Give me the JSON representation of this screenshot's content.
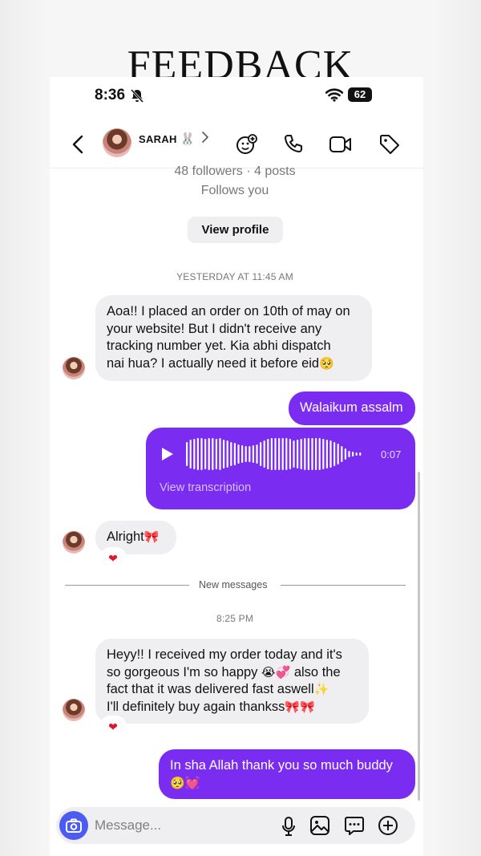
{
  "banner": {
    "title": "FEEDBACK"
  },
  "status_bar": {
    "time": "8:36",
    "battery": "62"
  },
  "header": {
    "contact_name": "SARAH",
    "name_emoji": "🐰"
  },
  "profile": {
    "followers_line": "48 followers · 4 posts",
    "follows_line": "Follows you",
    "view_profile_label": "View profile"
  },
  "thread": {
    "timestamp_1": "YESTERDAY AT 11:45 AM",
    "msg_1": {
      "line1": "Aoa!! I placed an order on 10th of may on",
      "line2": "your website! But I didn't receive any",
      "line3": "tracking number yet. Kia abhi dispatch",
      "line4": "nai hua? I actually need it before eid",
      "emoji": "🥺"
    },
    "msg_2": {
      "text": "Walaikum assalm"
    },
    "voice_note": {
      "duration": "0:07",
      "transcription_label": "View transcription"
    },
    "msg_3": {
      "text": "Alright",
      "emoji": "🎀",
      "reaction": "❤"
    },
    "divider_label": "New messages",
    "timestamp_2": "8:25 PM",
    "msg_4": {
      "line1": "Heyy!! I received my order today and it's",
      "line2a": "so gorgeous I'm so happy",
      "line2_emoji": "😭💞",
      "line2b": "also the",
      "line3": "fact that it was delivered fast aswell",
      "line3_emoji": "✨",
      "line4": "I'll definitely buy again thankss",
      "line4_emoji": "🎀🎀",
      "reaction": "❤"
    },
    "msg_5": {
      "line1": "In sha Allah thank you so much buddy",
      "line2_emoji": "🥺💓"
    }
  },
  "composer": {
    "placeholder": "Message..."
  },
  "colors": {
    "outgoing_bubble": "#7a2cf0",
    "incoming_bubble": "#efeff2",
    "camera_button": "#4c5cf2"
  }
}
